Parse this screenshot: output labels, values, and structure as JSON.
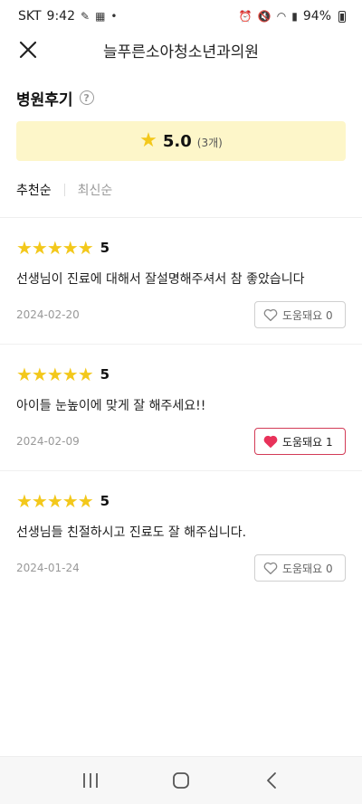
{
  "status_bar": {
    "carrier": "SKT",
    "time": "9:42",
    "battery": "94%"
  },
  "header": {
    "title": "늘푸른소아청소년과의원"
  },
  "section": {
    "title": "병원후기",
    "help": "?"
  },
  "rating": {
    "star": "★",
    "score": "5.0",
    "count": "(3개)"
  },
  "sort": {
    "recommended": "추천순",
    "latest": "최신순"
  },
  "reviews": [
    {
      "stars": "★★★★★",
      "score": "5",
      "text": "선생님이 진료에 대해서 잘설명해주셔서 참 좋았습니다",
      "date": "2024-02-20",
      "helpful_label": "도움돼요 0",
      "helpful_active": false
    },
    {
      "stars": "★★★★★",
      "score": "5",
      "text": "아이들 눈높이에 맞게 잘 해주세요!!",
      "date": "2024-02-09",
      "helpful_label": "도움돼요 1",
      "helpful_active": true
    },
    {
      "stars": "★★★★★",
      "score": "5",
      "text": "선생님들 친절하시고 진료도 잘 해주십니다.",
      "date": "2024-01-24",
      "helpful_label": "도움돼요 0",
      "helpful_active": false
    }
  ],
  "colors": {
    "star": "#f3c81b",
    "rating_bg": "#fdf6c9",
    "heart_active": "#e8325a"
  }
}
